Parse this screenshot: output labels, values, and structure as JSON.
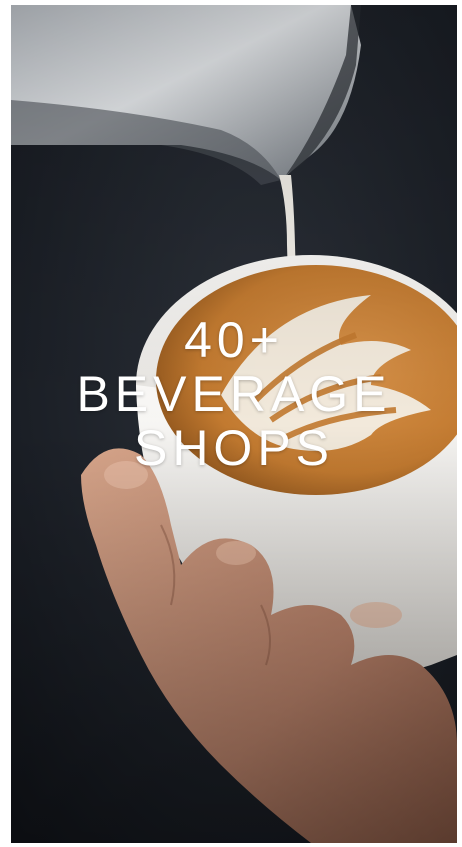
{
  "promo": {
    "headline_lines": [
      "40+",
      "BEVERAGE",
      "SHOPS"
    ],
    "image_subject": "latte-art-pour"
  },
  "colors": {
    "background": "#1c2027",
    "page": "#ffffff",
    "cup": "#f2f1ee",
    "crema": "#c98433",
    "milk": "#f4f1ea",
    "hand": "#c69276",
    "headline_text": "#ffffff"
  }
}
